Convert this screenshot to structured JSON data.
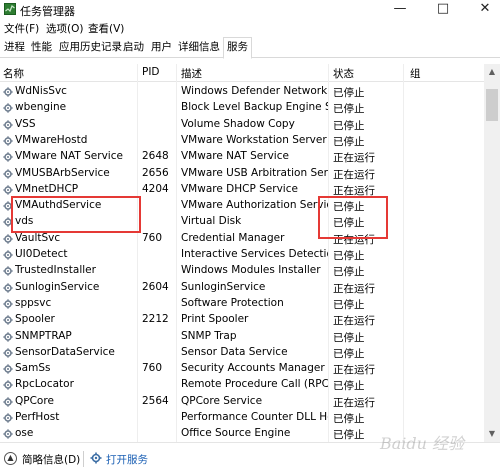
{
  "window": {
    "title": "任务管理器"
  },
  "menu": [
    "文件(F)",
    "选项(O)",
    "查看(V)"
  ],
  "tabs": [
    "进程",
    "性能",
    "应用历史记录",
    "启动",
    "用户",
    "详细信息",
    "服务"
  ],
  "active_tab": "服务",
  "columns": {
    "name": "名称",
    "pid": "PID",
    "desc": "描述",
    "status": "状态",
    "group": "组"
  },
  "rows": [
    {
      "name": "WdNisSvc",
      "pid": "",
      "desc": "Windows Defender Network I...",
      "status": "已停止"
    },
    {
      "name": "wbengine",
      "pid": "",
      "desc": "Block Level Backup Engine Se...",
      "status": "已停止"
    },
    {
      "name": "VSS",
      "pid": "",
      "desc": "Volume Shadow Copy",
      "status": "已停止"
    },
    {
      "name": "VMwareHostd",
      "pid": "",
      "desc": "VMware Workstation Server",
      "status": "已停止"
    },
    {
      "name": "VMware NAT Service",
      "pid": "2648",
      "desc": "VMware NAT Service",
      "status": "正在运行"
    },
    {
      "name": "VMUSBArbService",
      "pid": "2656",
      "desc": "VMware USB Arbitration Serv...",
      "status": "正在运行"
    },
    {
      "name": "VMnetDHCP",
      "pid": "4204",
      "desc": "VMware DHCP Service",
      "status": "正在运行"
    },
    {
      "name": "VMAuthdService",
      "pid": "",
      "desc": "VMware Authorization Service",
      "status": "已停止"
    },
    {
      "name": "vds",
      "pid": "",
      "desc": "Virtual Disk",
      "status": "已停止"
    },
    {
      "name": "VaultSvc",
      "pid": "760",
      "desc": "Credential Manager",
      "status": "正在运行"
    },
    {
      "name": "UI0Detect",
      "pid": "",
      "desc": "Interactive Services Detection",
      "status": "已停止"
    },
    {
      "name": "TrustedInstaller",
      "pid": "",
      "desc": "Windows Modules Installer",
      "status": "已停止"
    },
    {
      "name": "SunloginService",
      "pid": "2604",
      "desc": "SunloginService",
      "status": "正在运行"
    },
    {
      "name": "sppsvc",
      "pid": "",
      "desc": "Software Protection",
      "status": "已停止"
    },
    {
      "name": "Spooler",
      "pid": "2212",
      "desc": "Print Spooler",
      "status": "正在运行"
    },
    {
      "name": "SNMPTRAP",
      "pid": "",
      "desc": "SNMP Trap",
      "status": "已停止"
    },
    {
      "name": "SensorDataService",
      "pid": "",
      "desc": "Sensor Data Service",
      "status": "已停止"
    },
    {
      "name": "SamSs",
      "pid": "760",
      "desc": "Security Accounts Manager",
      "status": "正在运行"
    },
    {
      "name": "RpcLocator",
      "pid": "",
      "desc": "Remote Procedure Call (RPC) ...",
      "status": "已停止"
    },
    {
      "name": "QPCore",
      "pid": "2564",
      "desc": "QPCore Service",
      "status": "正在运行"
    },
    {
      "name": "PerfHost",
      "pid": "",
      "desc": "Performance Counter DLL Host",
      "status": "已停止"
    },
    {
      "name": "ose",
      "pid": "",
      "desc": "Office  Source Engine",
      "status": "已停止"
    }
  ],
  "statusbar": {
    "less_details": "简略信息(D)",
    "open_services": "打开服务"
  },
  "watermark": "Baidu 经验",
  "colors": {
    "highlight": "#e53935",
    "link": "#1a5fb4"
  },
  "icons": {
    "app": "task-manager-icon",
    "service": "gear-icon",
    "less": "chevron-up-icon",
    "open": "gear-icon"
  }
}
